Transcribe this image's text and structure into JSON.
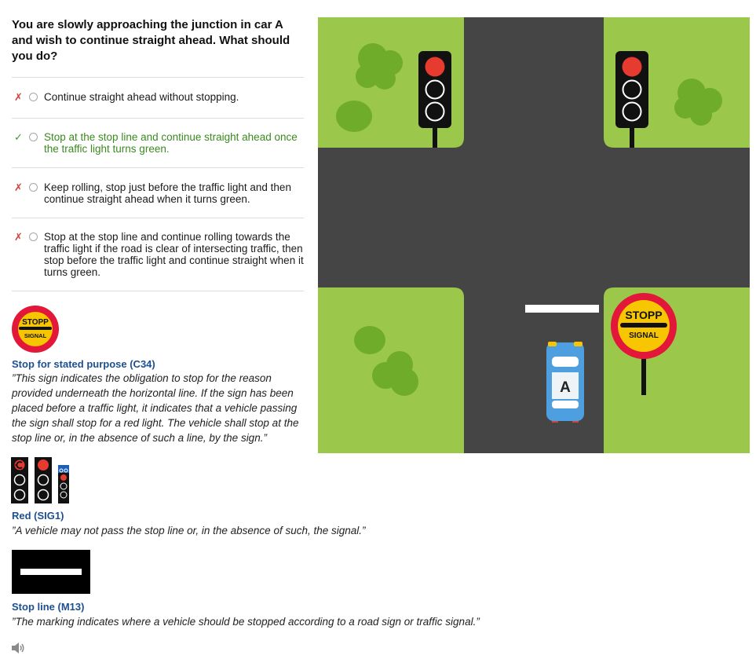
{
  "question": "You are slowly approaching the junction in car A and wish to continue straight ahead. What should you do?",
  "answers": [
    {
      "status": "wrong",
      "mark": "✗",
      "text": "Continue straight ahead without stopping."
    },
    {
      "status": "correct",
      "mark": "✓",
      "text": "Stop at the stop line and continue straight ahead once the traffic light turns green."
    },
    {
      "status": "wrong",
      "mark": "✗",
      "text": "Keep rolling, stop just before the traffic light and then continue straight ahead when it turns green."
    },
    {
      "status": "wrong",
      "mark": "✗",
      "text": "Stop at the stop line and continue rolling towards the traffic light if the road is clear of intersecting traffic, then stop before the traffic light and continue straight when it turns green."
    }
  ],
  "signs": [
    {
      "title": "Stop for stated purpose (C34)",
      "description": "”This sign indicates the obligation to stop for the reason provided underneath the horizontal line. If the sign has been placed before a traffic light, it indicates that a vehicle passing the sign shall stop for a red light. The vehicle shall stop at the stop line or, in the absence of such a line, by the sign.”",
      "icon_text_top": "STOPP",
      "icon_text_bottom": "SIGNAL"
    },
    {
      "title": "Red (SIG1)",
      "description": "”A vehicle may not pass the stop line or, in the absence of such, the signal.”"
    },
    {
      "title": "Stop line (M13)",
      "description": "”The marking indicates where a vehicle should be stopped according to a road sign or traffic signal.”"
    }
  ],
  "scene": {
    "car_label": "A",
    "sign_text_top": "STOPP",
    "sign_text_bottom": "SIGNAL"
  },
  "colors": {
    "grass": "#9bc84a",
    "road": "#454545",
    "bush": "#6fac2a",
    "red_light": "#e63b2e",
    "sign_red": "#e2173a",
    "sign_yellow": "#f7c600",
    "car_blue": "#4e9fe0",
    "correct_text": "#3b8a1f",
    "link_blue": "#1d4f91"
  },
  "icons": [
    "wrong-mark-icon",
    "correct-mark-icon",
    "radio-icon",
    "speaker-icon"
  ]
}
